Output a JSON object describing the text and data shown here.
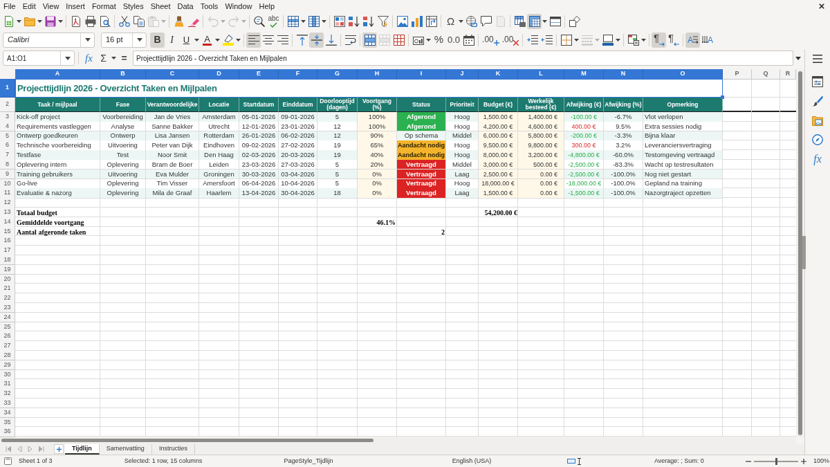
{
  "menu_bar": {
    "items": [
      "File",
      "Edit",
      "View",
      "Insert",
      "Format",
      "Styles",
      "Sheet",
      "Data",
      "Tools",
      "Window",
      "Help"
    ]
  },
  "standard_toolbar": {
    "paste": {
      "disabled": true
    },
    "undo": {
      "disabled": true
    },
    "redo": {
      "disabled": true
    },
    "spelling": {
      "label": "abc"
    },
    "special_character": {
      "label": "Ω"
    },
    "headers_footers": {
      "disabled": true
    },
    "freeze_cells": {
      "on": true
    }
  },
  "formatting_toolbar": {
    "font_name": "Calibri",
    "font_size": "16 pt",
    "bold": {
      "label": "B",
      "on": true
    },
    "italic": {
      "label": "I",
      "on": false
    },
    "underline": {
      "label": "U",
      "on": false
    },
    "font_color": {
      "label": "A"
    },
    "align_left": {
      "on": true
    },
    "align_center": {
      "on": false
    },
    "align_right": {
      "on": false
    },
    "align_top": {
      "on": false
    },
    "align_middle": {
      "on": true
    },
    "align_bottom": {
      "on": false
    },
    "wrap_text": {
      "on": false
    },
    "merge_and_center": {
      "on": true
    },
    "merge_cells": {
      "disabled": true
    },
    "percent": {
      "label": "%"
    },
    "number": {
      "label": "0.0"
    },
    "add_decimal": {
      "label": ".00"
    },
    "delete_decimal": {
      "label": ".00"
    },
    "border_style": {
      "disabled": true
    },
    "left_to_right": {
      "label": "¶",
      "on": true
    },
    "right_to_left": {
      "label": "¶",
      "on": false
    },
    "text_horizontal": {
      "label": "A",
      "on": true
    },
    "text_vertical": {
      "label": "A",
      "on": false
    }
  },
  "formula_bar": {
    "name_box": "A1:O1",
    "function_wizard": "fx",
    "sum": "Σ",
    "equals": "=",
    "content": "Projecttijdlijn 2026 - Overzicht Taken en Mijlpalen"
  },
  "sidebar": {
    "functions": "fx"
  },
  "sheet": {
    "column_headers": [
      {
        "label": "A",
        "selected": true
      },
      {
        "label": "B",
        "selected": true
      },
      {
        "label": "C",
        "selected": true
      },
      {
        "label": "D",
        "selected": true
      },
      {
        "label": "E",
        "selected": true
      },
      {
        "label": "F",
        "selected": true
      },
      {
        "label": "G",
        "selected": true
      },
      {
        "label": "H",
        "selected": true
      },
      {
        "label": "I",
        "selected": true
      },
      {
        "label": "J",
        "selected": true
      },
      {
        "label": "K",
        "selected": true
      },
      {
        "label": "L",
        "selected": true
      },
      {
        "label": "M",
        "selected": true
      },
      {
        "label": "N",
        "selected": true
      },
      {
        "label": "O",
        "selected": true
      },
      {
        "label": "P",
        "selected": false
      },
      {
        "label": "Q",
        "selected": false
      },
      {
        "label": "R",
        "selected": false
      }
    ],
    "row_headers": [
      {
        "label": "1",
        "selected": true
      },
      {
        "label": "2",
        "selected": false
      },
      {
        "label": "3",
        "selected": false
      },
      {
        "label": "4",
        "selected": false
      },
      {
        "label": "5",
        "selected": false
      },
      {
        "label": "6",
        "selected": false
      },
      {
        "label": "7",
        "selected": false
      },
      {
        "label": "8",
        "selected": false
      },
      {
        "label": "9",
        "selected": false
      },
      {
        "label": "10",
        "selected": false
      },
      {
        "label": "11",
        "selected": false
      },
      {
        "label": "12",
        "selected": false
      },
      {
        "label": "13",
        "selected": false
      },
      {
        "label": "14",
        "selected": false
      },
      {
        "label": "15",
        "selected": false
      },
      {
        "label": "16",
        "selected": false
      },
      {
        "label": "17",
        "selected": false
      },
      {
        "label": "18",
        "selected": false
      },
      {
        "label": "19",
        "selected": false
      },
      {
        "label": "20",
        "selected": false
      },
      {
        "label": "21",
        "selected": false
      },
      {
        "label": "22",
        "selected": false
      },
      {
        "label": "23",
        "selected": false
      },
      {
        "label": "24",
        "selected": false
      },
      {
        "label": "25",
        "selected": false
      },
      {
        "label": "26",
        "selected": false
      },
      {
        "label": "27",
        "selected": false
      },
      {
        "label": "28",
        "selected": false
      },
      {
        "label": "29",
        "selected": false
      },
      {
        "label": "30",
        "selected": false
      },
      {
        "label": "31",
        "selected": false
      },
      {
        "label": "32",
        "selected": false
      },
      {
        "label": "33",
        "selected": false
      },
      {
        "label": "34",
        "selected": false
      },
      {
        "label": "35",
        "selected": false
      },
      {
        "label": "36",
        "selected": false
      }
    ],
    "title": "Projecttijdlijn 2026 - Overzicht Taken en Mijlpalen",
    "columns": [
      "Taak / mijlpaal",
      "Fase",
      "Verantwoordelijke",
      "Locatie",
      "Startdatum",
      "Einddatum",
      "Doorlooptijd (dagen)",
      "Voortgang (%)",
      "Status",
      "Prioriteit",
      "Budget (€)",
      "Werkelijk besteed (€)",
      "Afwijking (€)",
      "Afwijking (%)",
      "Opmerking"
    ],
    "rows": [
      {
        "task": "Kick-off project",
        "phase": "Voorbereiding",
        "owner": "Jan de Vries",
        "location": "Amsterdam",
        "start": "05-01-2026",
        "end": "09-01-2026",
        "duration": "5",
        "progress": "100%",
        "status": {
          "label": "Afgerond",
          "kind": "done"
        },
        "priority": "Hoog",
        "budget": "1,500.00 €",
        "spent": "1,400.00 €",
        "deviation": "-100.00 €",
        "over_budget": false,
        "deviation_pct": "-6.7%",
        "remark": "Vlot verlopen"
      },
      {
        "task": "Requirements vastleggen",
        "phase": "Analyse",
        "owner": "Sanne Bakker",
        "location": "Utrecht",
        "start": "12-01-2026",
        "end": "23-01-2026",
        "duration": "12",
        "progress": "100%",
        "status": {
          "label": "Afgerond",
          "kind": "done"
        },
        "priority": "Hoog",
        "budget": "4,200.00 €",
        "spent": "4,600.00 €",
        "deviation": "400.00 €",
        "over_budget": true,
        "deviation_pct": "9.5%",
        "remark": "Extra sessies nodig"
      },
      {
        "task": "Ontwerp goedkeuren",
        "phase": "Ontwerp",
        "owner": "Lisa Jansen",
        "location": "Rotterdam",
        "start": "26-01-2026",
        "end": "06-02-2026",
        "duration": "12",
        "progress": "90%",
        "status": {
          "label": "Op schema",
          "kind": "on_track"
        },
        "priority": "Middel",
        "budget": "6,000.00 €",
        "spent": "5,800.00 €",
        "deviation": "-200.00 €",
        "over_budget": false,
        "deviation_pct": "-3.3%",
        "remark": "Bijna klaar"
      },
      {
        "task": "Technische voorbereiding",
        "phase": "Uitvoering",
        "owner": "Peter van Dijk",
        "location": "Eindhoven",
        "start": "09-02-2026",
        "end": "27-02-2026",
        "duration": "19",
        "progress": "65%",
        "status": {
          "label": "Aandacht nodig",
          "kind": "attention"
        },
        "priority": "Hoog",
        "budget": "9,500.00 €",
        "spent": "9,800.00 €",
        "deviation": "300.00 €",
        "over_budget": true,
        "deviation_pct": "3.2%",
        "remark": "Leveranciersvertraging"
      },
      {
        "task": "Testfase",
        "phase": "Test",
        "owner": "Noor Smit",
        "location": "Den Haag",
        "start": "02-03-2026",
        "end": "20-03-2026",
        "duration": "19",
        "progress": "40%",
        "status": {
          "label": "Aandacht nodig",
          "kind": "attention"
        },
        "priority": "Hoog",
        "budget": "8,000.00 €",
        "spent": "3,200.00 €",
        "deviation": "-4,800.00 €",
        "over_budget": false,
        "deviation_pct": "-60.0%",
        "remark": "Testomgeving vertraagd"
      },
      {
        "task": "Oplevering intern",
        "phase": "Oplevering",
        "owner": "Bram de Boer",
        "location": "Leiden",
        "start": "23-03-2026",
        "end": "27-03-2026",
        "duration": "5",
        "progress": "20%",
        "status": {
          "label": "Vertraagd",
          "kind": "delayed"
        },
        "priority": "Middel",
        "budget": "3,000.00 €",
        "spent": "500.00 €",
        "deviation": "-2,500.00 €",
        "over_budget": false,
        "deviation_pct": "-83.3%",
        "remark": "Wacht op testresultaten"
      },
      {
        "task": "Training gebruikers",
        "phase": "Uitvoering",
        "owner": "Eva Mulder",
        "location": "Groningen",
        "start": "30-03-2026",
        "end": "03-04-2026",
        "duration": "5",
        "progress": "0%",
        "status": {
          "label": "Vertraagd",
          "kind": "delayed"
        },
        "priority": "Laag",
        "budget": "2,500.00 €",
        "spent": "0.00 €",
        "deviation": "-2,500.00 €",
        "over_budget": false,
        "deviation_pct": "-100.0%",
        "remark": "Nog niet gestart"
      },
      {
        "task": "Go-live",
        "phase": "Oplevering",
        "owner": "Tim Visser",
        "location": "Amersfoort",
        "start": "06-04-2026",
        "end": "10-04-2026",
        "duration": "5",
        "progress": "0%",
        "status": {
          "label": "Vertraagd",
          "kind": "delayed"
        },
        "priority": "Hoog",
        "budget": "18,000.00 €",
        "spent": "0.00 €",
        "deviation": "-18,000.00 €",
        "over_budget": false,
        "deviation_pct": "-100.0%",
        "remark": "Gepland na training"
      },
      {
        "task": "Evaluatie & nazorg",
        "phase": "Oplevering",
        "owner": "Mila de Graaf",
        "location": "Haarlem",
        "start": "13-04-2026",
        "end": "30-04-2026",
        "duration": "18",
        "progress": "0%",
        "status": {
          "label": "Vertraagd",
          "kind": "delayed"
        },
        "priority": "Laag",
        "budget": "1,500.00 €",
        "spent": "0.00 €",
        "deviation": "-1,500.00 €",
        "over_budget": false,
        "deviation_pct": "-100.0%",
        "remark": "Nazorgtraject opzetten"
      }
    ],
    "summary_rows": [
      {
        "label": "Totaal budget",
        "budget": "54,200.00 €"
      },
      {
        "label": "Gemiddelde voortgang",
        "progress": "46.1%"
      },
      {
        "label": "Aantal afgeronde taken",
        "status": "2"
      }
    ]
  },
  "sheet_tabs": [
    {
      "label": "Tijdlijn",
      "selected": true
    },
    {
      "label": "Samenvatting",
      "selected": false
    },
    {
      "label": "Instructies",
      "selected": false
    }
  ],
  "status_bar": {
    "sheet": "Sheet 1 of 3",
    "selection": "Selected: 1 row, 15 columns",
    "page_style": "PageStyle_Tijdlijn",
    "language": "English (USA)",
    "sum": "Average: ; Sum: 0",
    "zoom_slider": {
      "level": 0.5
    },
    "zoom": "100%"
  }
}
